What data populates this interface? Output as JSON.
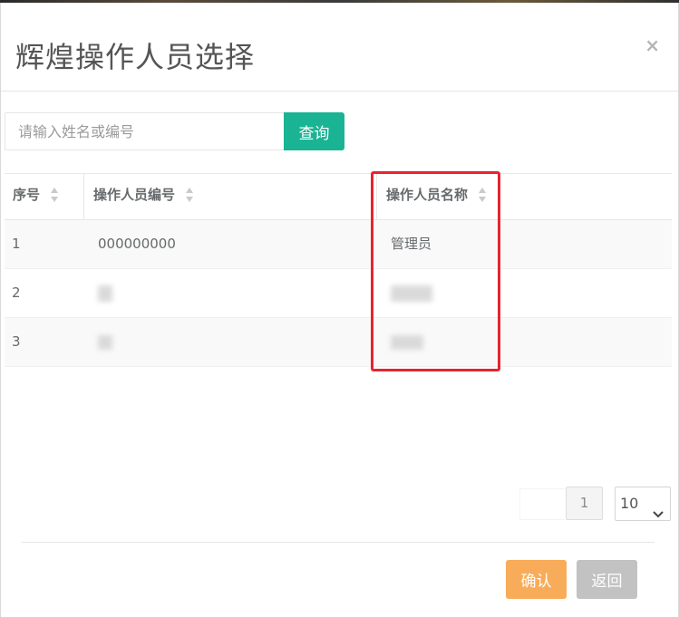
{
  "modal": {
    "title": "辉煌操作人员选择",
    "close_glyph": "×"
  },
  "search": {
    "placeholder": "请输入姓名或编号",
    "query_label": "查询"
  },
  "table": {
    "columns": [
      "序号",
      "操作人员编号",
      "操作人员名称"
    ],
    "rows": [
      {
        "index": "1",
        "code": "000000000",
        "name": "管理员"
      },
      {
        "index": "2",
        "code": "",
        "name": ""
      },
      {
        "index": "3",
        "code": "",
        "name": ""
      }
    ]
  },
  "pagination": {
    "current_page": "1",
    "page_size": "10"
  },
  "footer": {
    "confirm_label": "确认",
    "back_label": "返回"
  },
  "colors": {
    "query_button": "#1ab394",
    "confirm_button": "#f8ac59",
    "back_button": "#c2c2c2",
    "highlight_border": "#e8242e"
  },
  "icons": {
    "sort": "sort-both-icon",
    "close": "close-icon",
    "select_arrow": "chevron-down-icon"
  }
}
